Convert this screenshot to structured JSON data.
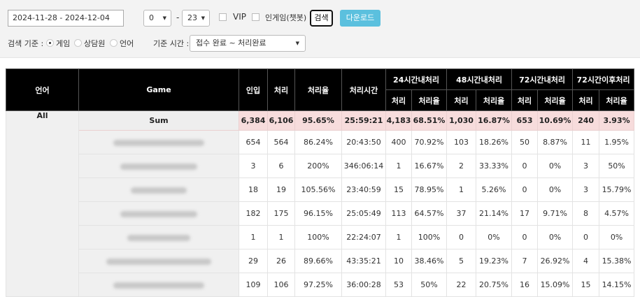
{
  "filters": {
    "date_range": "2024-11-28 - 2024-12-04",
    "start_hour": "0",
    "end_hour": "23",
    "range_sep": "-",
    "vip_label": "VIP",
    "ingame_label": "인게임(챗봇)",
    "search_button": "검색",
    "download_button": "다운로드",
    "search_basis_label": "검색 기준 :",
    "basis_options": [
      "게임",
      "상담원",
      "언어"
    ],
    "time_basis_label": "기준 시간 :",
    "time_basis_value": "접수 완료 ~ 처리완료"
  },
  "table": {
    "headers": {
      "lang": "언어",
      "game": "Game",
      "inflow": "인입",
      "processed": "처리",
      "rate": "처리율",
      "process_time": "처리시간",
      "h24": "24시간내처리",
      "h48": "48시간내처리",
      "h72": "72시간내처리",
      "h72plus": "72시간이후처리",
      "sub_processed": "처리",
      "sub_rate": "처리율"
    },
    "lang_value": "All",
    "sum_label": "Sum",
    "sum": [
      "6,384",
      "6,106",
      "95.65%",
      "25:59:21",
      "4,183",
      "68.51%",
      "1,030",
      "16.87%",
      "653",
      "10.69%",
      "240",
      "3.93%"
    ],
    "rows": [
      [
        "654",
        "564",
        "86.24%",
        "20:43:50",
        "400",
        "70.92%",
        "103",
        "18.26%",
        "50",
        "8.87%",
        "11",
        "1.95%"
      ],
      [
        "3",
        "6",
        "200%",
        "346:06:14",
        "1",
        "16.67%",
        "2",
        "33.33%",
        "0",
        "0%",
        "3",
        "50%"
      ],
      [
        "18",
        "19",
        "105.56%",
        "23:40:59",
        "15",
        "78.95%",
        "1",
        "5.26%",
        "0",
        "0%",
        "3",
        "15.79%"
      ],
      [
        "182",
        "175",
        "96.15%",
        "25:05:49",
        "113",
        "64.57%",
        "37",
        "21.14%",
        "17",
        "9.71%",
        "8",
        "4.57%"
      ],
      [
        "1",
        "1",
        "100%",
        "22:24:07",
        "1",
        "100%",
        "0",
        "0%",
        "0",
        "0%",
        "0",
        "0%"
      ],
      [
        "29",
        "26",
        "89.66%",
        "43:35:21",
        "10",
        "38.46%",
        "5",
        "19.23%",
        "7",
        "26.92%",
        "4",
        "15.38%"
      ],
      [
        "109",
        "106",
        "97.25%",
        "36:00:28",
        "53",
        "50%",
        "22",
        "20.75%",
        "16",
        "15.09%",
        "15",
        "14.15%"
      ]
    ]
  }
}
